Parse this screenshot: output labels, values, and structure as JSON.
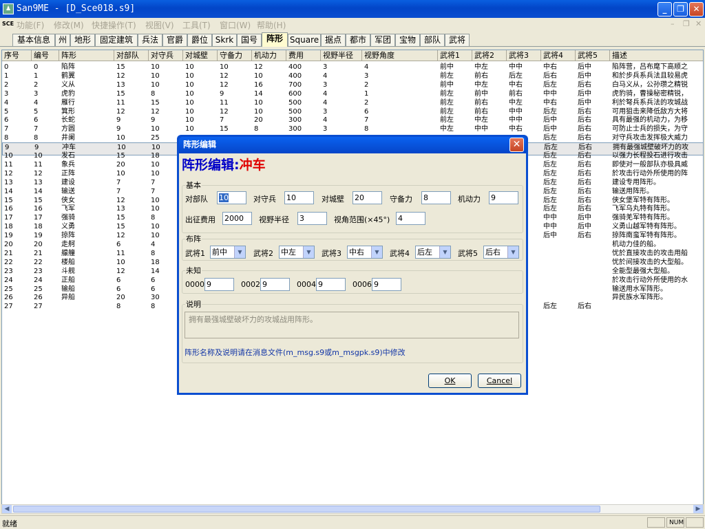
{
  "window": {
    "title": "San9ME - [D_Sce018.s9]"
  },
  "menu": {
    "logo": "SCE",
    "items": [
      "功能(F)",
      "修改(M)",
      "快捷操作(T)",
      "视图(V)",
      "工具(T)",
      "窗口(W)",
      "帮助(H)"
    ]
  },
  "tabs": [
    "基本信息",
    "州",
    "地形",
    "固定建筑",
    "兵法",
    "官爵",
    "爵位",
    "Skrk",
    "国号",
    "阵形",
    "Square",
    "据点",
    "都市",
    "军团",
    "宝物",
    "部队",
    "武将"
  ],
  "active_tab": "阵形",
  "grid": {
    "columns": [
      "序号",
      "编号",
      "阵形",
      "对部队",
      "对守兵",
      "对城壁",
      "守备力",
      "机动力",
      "费用",
      "视野半径",
      "视野角度",
      "武将1",
      "武将2",
      "武将3",
      "武将4",
      "武将5",
      "描述"
    ],
    "rows": [
      [
        "0",
        "0",
        "陷阵",
        "15",
        "10",
        "10",
        "10",
        "12",
        "400",
        "3",
        "4",
        "前中",
        "中左",
        "中中",
        "中右",
        "后中",
        "陷阵营，吕布麾下高顺之"
      ],
      [
        "1",
        "1",
        "鹤翼",
        "12",
        "10",
        "10",
        "12",
        "10",
        "400",
        "4",
        "3",
        "前左",
        "前右",
        "后左",
        "后右",
        "后中",
        "和於步兵系兵法且较易虎"
      ],
      [
        "2",
        "2",
        "义从",
        "13",
        "10",
        "10",
        "12",
        "16",
        "700",
        "3",
        "2",
        "前中",
        "中左",
        "中右",
        "后左",
        "后右",
        "白马义从，公孙瓒之精锐"
      ],
      [
        "3",
        "3",
        "虎豹",
        "15",
        "8",
        "10",
        "9",
        "14",
        "600",
        "4",
        "1",
        "前左",
        "前中",
        "前右",
        "中中",
        "后中",
        "虎豹骑，曹操秘密精锐，"
      ],
      [
        "4",
        "4",
        "雁行",
        "11",
        "15",
        "10",
        "11",
        "10",
        "500",
        "4",
        "2",
        "前左",
        "前右",
        "中左",
        "中右",
        "后中",
        "利於弩兵系兵法的攻城战"
      ],
      [
        "5",
        "5",
        "箕形",
        "12",
        "12",
        "10",
        "12",
        "10",
        "500",
        "3",
        "6",
        "前左",
        "前右",
        "中中",
        "后左",
        "后右",
        "可用狙击来降低敌方大将"
      ],
      [
        "6",
        "6",
        "长蛇",
        "9",
        "9",
        "10",
        "7",
        "20",
        "300",
        "4",
        "7",
        "前左",
        "中左",
        "中中",
        "后中",
        "后右",
        "具有最强的机动力，为移"
      ],
      [
        "7",
        "7",
        "方圆",
        "9",
        "10",
        "10",
        "15",
        "8",
        "300",
        "3",
        "8",
        "中左",
        "中中",
        "中右",
        "后中",
        "后右",
        "可防止士兵的损失，为守"
      ],
      [
        "8",
        "8",
        "井阑",
        "10",
        "25",
        "",
        "",
        "",
        "",
        "",
        "",
        "",
        "",
        "",
        "后左",
        "后右",
        "对守兵攻击发挥极大威力"
      ],
      [
        "9",
        "9",
        "冲车",
        "10",
        "10",
        "",
        "",
        "",
        "",
        "",
        "",
        "",
        "",
        "",
        "后左",
        "后右",
        "拥有最强城壁破坏力的攻"
      ],
      [
        "10",
        "10",
        "发石",
        "15",
        "18",
        "",
        "",
        "",
        "",
        "",
        "",
        "",
        "",
        "",
        "后左",
        "后右",
        "以强力长程投石进行攻击"
      ],
      [
        "11",
        "11",
        "象兵",
        "20",
        "10",
        "",
        "",
        "",
        "",
        "",
        "",
        "",
        "",
        "",
        "后左",
        "后右",
        "即使对一般部队亦极具威"
      ],
      [
        "12",
        "12",
        "正阵",
        "10",
        "10",
        "",
        "",
        "",
        "",
        "",
        "",
        "",
        "",
        "",
        "后左",
        "后右",
        "於攻击行动外所使用的阵"
      ],
      [
        "13",
        "13",
        "建设",
        "7",
        "7",
        "",
        "",
        "",
        "",
        "",
        "",
        "",
        "",
        "",
        "后左",
        "后右",
        "建设专用阵形。"
      ],
      [
        "14",
        "14",
        "输送",
        "7",
        "7",
        "",
        "",
        "",
        "",
        "",
        "",
        "",
        "",
        "",
        "后左",
        "后右",
        "输送用阵形。"
      ],
      [
        "15",
        "15",
        "侠女",
        "12",
        "10",
        "",
        "",
        "",
        "",
        "",
        "",
        "",
        "",
        "",
        "后左",
        "后右",
        "侠女堡军特有阵形。"
      ],
      [
        "16",
        "16",
        "飞军",
        "13",
        "10",
        "",
        "",
        "",
        "",
        "",
        "",
        "",
        "",
        "",
        "后左",
        "后右",
        "飞军乌丸特有阵形。"
      ],
      [
        "17",
        "17",
        "强骑",
        "15",
        "8",
        "",
        "",
        "",
        "",
        "",
        "",
        "",
        "",
        "",
        "中中",
        "后中",
        "强骑羌军特有阵形。"
      ],
      [
        "18",
        "18",
        "义勇",
        "15",
        "10",
        "",
        "",
        "",
        "",
        "",
        "",
        "",
        "",
        "",
        "中中",
        "后中",
        "义勇山越军特有阵形。"
      ],
      [
        "19",
        "19",
        "掠阵",
        "12",
        "10",
        "",
        "",
        "",
        "",
        "",
        "",
        "",
        "",
        "",
        "后中",
        "后右",
        "掠阵南蛮军特有阵形。"
      ],
      [
        "20",
        "20",
        "走舸",
        "6",
        "4",
        "",
        "",
        "",
        "",
        "",
        "",
        "",
        "",
        "",
        "",
        "",
        "机动力佳的船。"
      ],
      [
        "21",
        "21",
        "艨艟",
        "11",
        "8",
        "",
        "",
        "",
        "",
        "",
        "",
        "",
        "",
        "",
        "",
        "",
        "忧於直接攻击的攻击用船"
      ],
      [
        "22",
        "22",
        "楼船",
        "10",
        "18",
        "",
        "",
        "",
        "",
        "",
        "",
        "",
        "",
        "",
        "",
        "",
        "忧於间接攻击的大型船。"
      ],
      [
        "23",
        "23",
        "斗舰",
        "12",
        "14",
        "",
        "",
        "",
        "",
        "",
        "",
        "",
        "",
        "",
        "",
        "",
        "全能型最强大型船。"
      ],
      [
        "24",
        "24",
        "正船",
        "6",
        "6",
        "",
        "",
        "",
        "",
        "",
        "",
        "",
        "",
        "",
        "",
        "",
        "於攻击行动外所使用的水"
      ],
      [
        "25",
        "25",
        "输船",
        "6",
        "6",
        "",
        "",
        "",
        "",
        "",
        "",
        "",
        "",
        "",
        "",
        "",
        "输送用水军阵形。"
      ],
      [
        "26",
        "26",
        "异船",
        "20",
        "30",
        "",
        "",
        "",
        "",
        "",
        "",
        "",
        "",
        "",
        "",
        "",
        "异民族水军阵形。"
      ],
      [
        "27",
        "27",
        "",
        "8",
        "8",
        "",
        "",
        "",
        "",
        "",
        "",
        "",
        "",
        "",
        "后左",
        "后右",
        ""
      ]
    ]
  },
  "status": {
    "text": "就绪",
    "num": "NUM"
  },
  "dialog": {
    "title": "阵形编辑",
    "heading_prefix": "阵形编辑:",
    "heading_name": "冲车",
    "basic": {
      "label": "基本",
      "vs_unit_label": "对部队",
      "vs_unit": "10",
      "vs_guard_label": "对守兵",
      "vs_guard": "10",
      "vs_wall_label": "对城壁",
      "vs_wall": "20",
      "defense_label": "守备力",
      "defense": "8",
      "mobility_label": "机动力",
      "mobility": "9",
      "cost_label": "出征费用",
      "cost": "2000",
      "view_radius_label": "视野半径",
      "view_radius": "3",
      "view_angle_label": "视角范围(×45°)",
      "view_angle": "4"
    },
    "layout": {
      "label": "布阵",
      "slots": [
        {
          "label": "武将1",
          "value": "前中"
        },
        {
          "label": "武将2",
          "value": "中左"
        },
        {
          "label": "武将3",
          "value": "中右"
        },
        {
          "label": "武将4",
          "value": "后左"
        },
        {
          "label": "武将5",
          "value": "后右"
        }
      ]
    },
    "unknown": {
      "label": "未知",
      "fields": [
        {
          "label": "0000",
          "value": "9"
        },
        {
          "label": "0002",
          "value": "9"
        },
        {
          "label": "0004",
          "value": "9"
        },
        {
          "label": "0006",
          "value": "9"
        }
      ]
    },
    "desc": {
      "label": "说明",
      "value": "拥有最强城壁破坏力的攻城战用阵形。"
    },
    "note": "阵形名称及说明请在消息文件(m_msg.s9或m_msgpk.s9)中修改",
    "ok": "OK",
    "cancel": "Cancel"
  }
}
